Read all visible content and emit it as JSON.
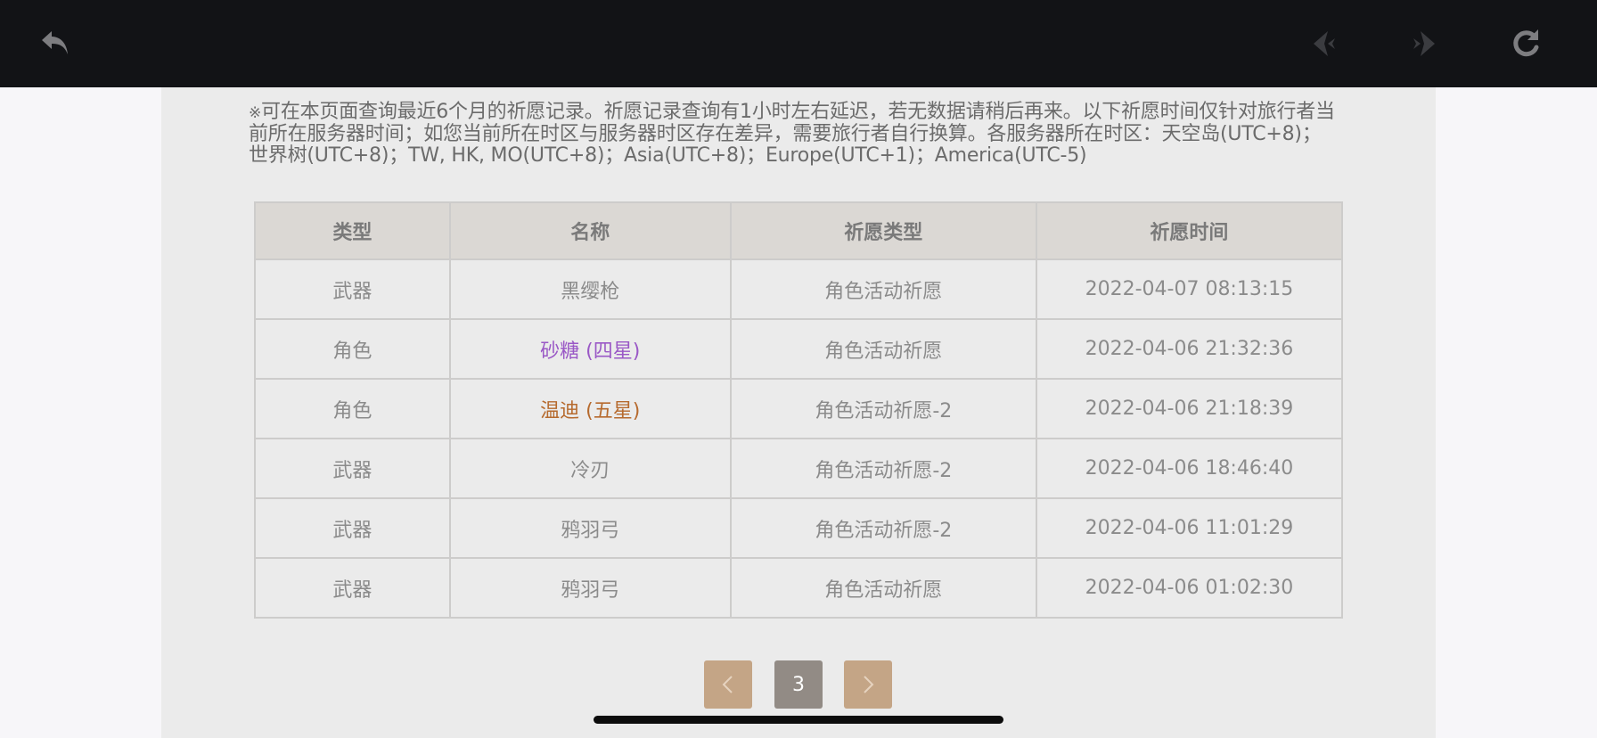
{
  "notice": {
    "mark": "※",
    "text": "可在本页面查询最近6个月的祈愿记录。祈愿记录查询有1小时左右延迟，若无数据请稍后再来。以下祈愿时间仅针对旅行者当前所在服务器时间；如您当前所在时区与服务器时区存在差异，需要旅行者自行换算。各服务器所在时区：天空岛(UTC+8)；世界树(UTC+8)；TW, HK, MO(UTC+8)；Asia(UTC+8)；Europe(UTC+1)；America(UTC-5)"
  },
  "table": {
    "headers": {
      "type": "类型",
      "name": "名称",
      "wish_type": "祈愿类型",
      "time": "祈愿时间"
    },
    "rows": [
      {
        "type": "武器",
        "name": "黑缨枪",
        "wish_type": "角色活动祈愿",
        "time": "2022-04-07 08:13:15",
        "color": "#8b8b8b"
      },
      {
        "type": "角色",
        "name": "砂糖 (四星)",
        "wish_type": "角色活动祈愿",
        "time": "2022-04-06 21:32:36",
        "color": "#9a58c6"
      },
      {
        "type": "角色",
        "name": "温迪 (五星)",
        "wish_type": "角色活动祈愿-2",
        "time": "2022-04-06 21:18:39",
        "color": "#b66a2e"
      },
      {
        "type": "武器",
        "name": "冷刃",
        "wish_type": "角色活动祈愿-2",
        "time": "2022-04-06 18:46:40",
        "color": "#8b8b8b"
      },
      {
        "type": "武器",
        "name": "鸦羽弓",
        "wish_type": "角色活动祈愿-2",
        "time": "2022-04-06 11:01:29",
        "color": "#8b8b8b"
      },
      {
        "type": "武器",
        "name": "鸦羽弓",
        "wish_type": "角色活动祈愿",
        "time": "2022-04-06 01:02:30",
        "color": "#8b8b8b"
      }
    ]
  },
  "pagination": {
    "current_page": "3",
    "prev_icon": "chevron-left-icon",
    "next_icon": "chevron-right-icon"
  },
  "toolbar": {
    "back_icon": "back-arrow-icon",
    "prev_icon": "nav-prev-icon",
    "next_icon": "nav-next-icon",
    "reload_icon": "reload-icon"
  },
  "colors": {
    "four_star": "#9a58c6",
    "five_star": "#b66a2e",
    "pager_accent": "#c4a586",
    "pager_current": "#928b85"
  }
}
